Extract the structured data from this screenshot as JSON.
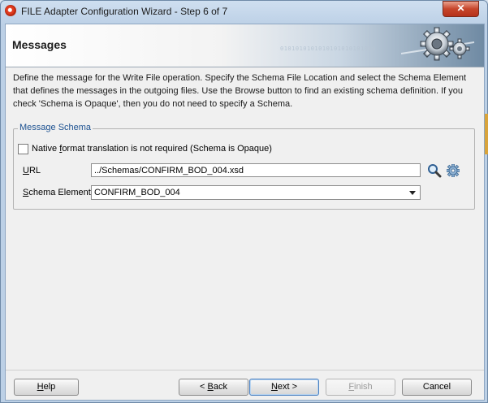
{
  "window": {
    "title": "FILE Adapter Configuration Wizard - Step 6 of 7",
    "close_symbol": "✕"
  },
  "header": {
    "title": "Messages",
    "binary_text": "0101010101010101010101010",
    "icon": "gear-wheels-icon"
  },
  "description": "Define the message for the Write File operation.  Specify the Schema File Location and select the Schema Element that defines the messages in the outgoing files. Use the Browse button to find an existing schema definition. If you check 'Schema is Opaque', then you do not need to specify a Schema.",
  "message_schema": {
    "legend": "Message Schema",
    "opaque_checkbox": {
      "label_pre": "Native ",
      "label_mnemonic": "f",
      "label_post": "ormat translation is not required (Schema is Opaque)",
      "checked": false
    },
    "url": {
      "label_mnemonic": "U",
      "label_post": "RL",
      "value": "../Schemas/CONFIRM_BOD_004.xsd",
      "browse_icon": "search-icon",
      "generate_icon": "gear-icon"
    },
    "schema_element": {
      "label_mnemonic": "S",
      "label_post": "chema Element",
      "value": "CONFIRM_BOD_004"
    }
  },
  "buttons": {
    "help": {
      "mnemonic": "H",
      "post": "elp"
    },
    "back": {
      "pre": "< ",
      "mnemonic": "B",
      "post": "ack"
    },
    "next": {
      "mnemonic": "N",
      "post": "ext >"
    },
    "finish": {
      "mnemonic": "F",
      "post": "inish"
    },
    "cancel": {
      "label": "Cancel"
    }
  },
  "colors": {
    "legend_text": "#1c5191",
    "close_button": "#c6452b"
  }
}
